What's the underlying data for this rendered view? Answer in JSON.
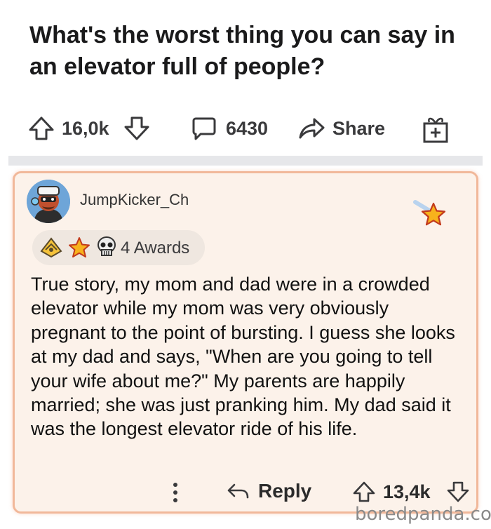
{
  "post": {
    "title": "What's the worst thing you can say in an elevator full of people?",
    "upvotes": "16,0k",
    "comments": "6430",
    "share_label": "Share"
  },
  "comment": {
    "username": "JumpKicker_Ch",
    "awards_label": "4 Awards",
    "body": "True story, my mom and dad were in a crowded elevator while my mom was very obviously pregnant to the point of bursting. I guess she looks at my dad and says, \"When are you going to tell your wife about me?\" My parents are happily married; she was just pranking him. My dad said it was the longest elevator ride of his life.",
    "reply_label": "Reply",
    "votes": "13,4k",
    "icons": [
      "avatar",
      "star-icon",
      "award-icons",
      "more-icon",
      "reply-arrow-icon",
      "upvote-icon",
      "downvote-icon"
    ]
  },
  "watermark": "boredpanda.com",
  "colors": {
    "card_bg": "#fcf2ea",
    "card_border": "#f1b89a",
    "text": "#1a1a1b",
    "icon": "#3a3a3c"
  }
}
